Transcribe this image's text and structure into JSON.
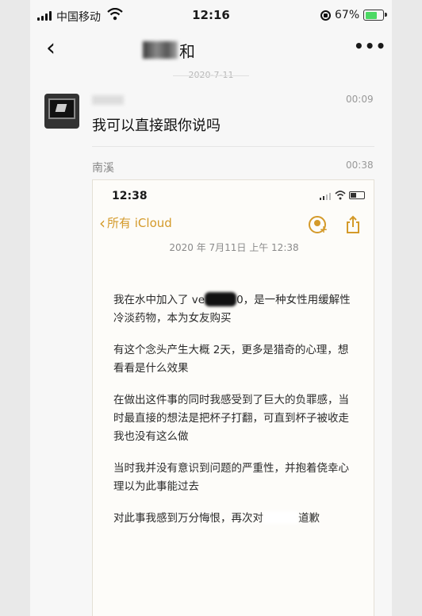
{
  "status_bar": {
    "carrier": "中国移动",
    "time": "12:16",
    "battery_pct": "67%",
    "battery_level": 0.67
  },
  "nav": {
    "title_visible": "和",
    "back_icon": "chevron-left-icon",
    "more_icon": "more-horizontal-icon"
  },
  "chat": {
    "date_separator": "2020-7-11",
    "messages": [
      {
        "time": "00:09",
        "text": "我可以直接跟你说吗"
      },
      {
        "sender": "南溪",
        "time": "00:38"
      }
    ]
  },
  "note": {
    "time": "12:38",
    "back_label": "所有 iCloud",
    "date": "2020 年 7月11日 上午 12:38",
    "p1a": "我在水中加入了 ve",
    "p1b": "0，是一种女性用缓解性冷淡药物，本为女友购买",
    "p2": "有这个念头产生大概 2天，更多是猎奇的心理，想看看是什么效果",
    "p3": "在做出这件事的同时我感受到了巨大的负罪感，当时最直接的想法是把杯子打翻，可直到杯子被收走我也没有这么做",
    "p4": "当时我并没有意识到问题的严重性，并抱着侥幸心理以为此事能过去",
    "p5a": "对此事我感到万分悔恨，再次对",
    "p5b": "道歉",
    "accent_color": "#d49a2a"
  }
}
